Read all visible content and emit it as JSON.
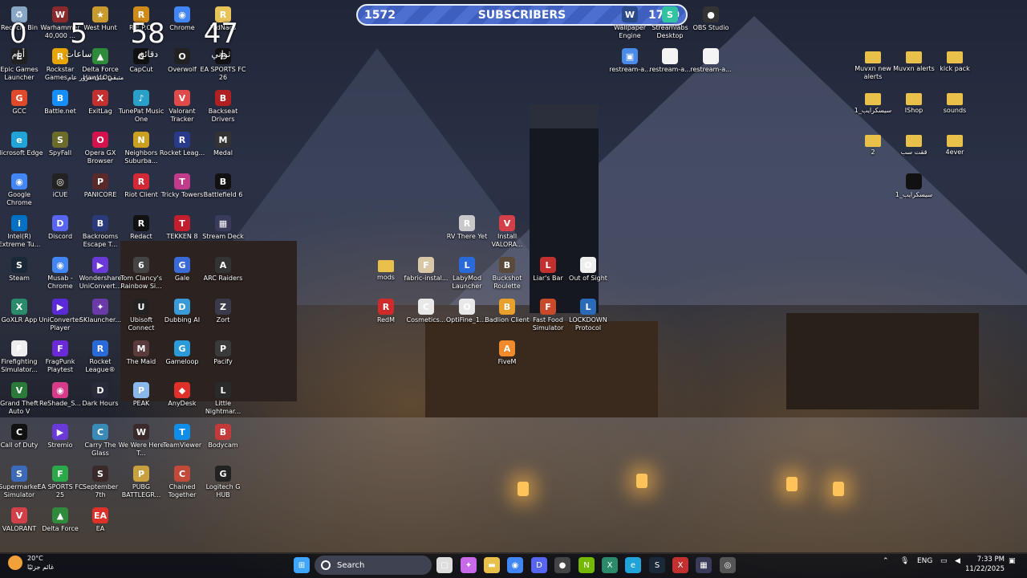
{
  "subscriber_bar": {
    "count": "1572",
    "label": "SUBSCRIBERS",
    "goal": "1700",
    "progress": 0.92
  },
  "countdown": [
    {
      "value": "0",
      "unit": "أيام"
    },
    {
      "value": "5",
      "unit": "ساعات"
    },
    {
      "value": "58",
      "unit": "دقائق"
    },
    {
      "value": "47",
      "unit": "ثواني"
    }
  ],
  "countdown_note": "متبقي على مرور عام",
  "desktop_icons": [
    {
      "label": "Recycle Bin",
      "icon": "recycle-bin-icon",
      "color": "#8aa6c7",
      "glyph": "♻"
    },
    {
      "label": "Warhammer 40,000 ...",
      "icon": "warhammer-icon",
      "color": "#8a2a2a",
      "glyph": "W"
    },
    {
      "label": "West Hunt",
      "icon": "west-hunt-icon",
      "color": "#c99a2e",
      "glyph": "★"
    },
    {
      "label": "R.E.P.O.",
      "icon": "repo-icon",
      "color": "#d08a1a",
      "glyph": "R"
    },
    {
      "label": "Chrome",
      "icon": "chrome-icon",
      "color": "#4285f4",
      "glyph": "◉"
    },
    {
      "label": "RidNacs",
      "icon": "ridnacs-icon",
      "color": "#e8c35a",
      "glyph": "R"
    },
    {
      "label": "Epic Games Launcher",
      "icon": "epic-games-icon",
      "color": "#222",
      "glyph": "E"
    },
    {
      "label": "Rockstar Games ...",
      "icon": "rockstar-icon",
      "color": "#e8a400",
      "glyph": "R"
    },
    {
      "label": "Delta Force Hawk Op...",
      "icon": "delta-force-icon",
      "color": "#2f8a3c",
      "glyph": "▲"
    },
    {
      "label": "CapCut",
      "icon": "capcut-icon",
      "color": "#111",
      "glyph": "C"
    },
    {
      "label": "Overwolf",
      "icon": "overwolf-icon",
      "color": "#222",
      "glyph": "O"
    },
    {
      "label": "EA SPORTS FC 26",
      "icon": "ea-fc26-icon",
      "color": "#111",
      "glyph": "F"
    },
    {
      "label": "GCC",
      "icon": "gcc-icon",
      "color": "#e04a2a",
      "glyph": "G"
    },
    {
      "label": "Battle.net",
      "icon": "battlenet-icon",
      "color": "#148eff",
      "glyph": "B"
    },
    {
      "label": "ExitLag",
      "icon": "exitlag-icon",
      "color": "#c23030",
      "glyph": "X"
    },
    {
      "label": "TunePat Music One",
      "icon": "tunepat-icon",
      "color": "#2aa0c8",
      "glyph": "♪"
    },
    {
      "label": "Valorant Tracker",
      "icon": "valorant-tracker-icon",
      "color": "#e04a4a",
      "glyph": "V"
    },
    {
      "label": "Backseat Drivers",
      "icon": "backseat-icon",
      "color": "#b02020",
      "glyph": "B"
    },
    {
      "label": "Microsoft Edge",
      "icon": "edge-icon",
      "color": "#1fa3d8",
      "glyph": "e"
    },
    {
      "label": "SpyFall",
      "icon": "spyfall-icon",
      "color": "#6b6b2a",
      "glyph": "S"
    },
    {
      "label": "Opera GX Browser",
      "icon": "opera-gx-icon",
      "color": "#d4124c",
      "glyph": "O"
    },
    {
      "label": "Neighbors Suburba...",
      "icon": "neighbors-icon",
      "color": "#c9a022",
      "glyph": "N"
    },
    {
      "label": "Rocket Leag...",
      "icon": "rocket-league-icon",
      "color": "#2a3a8a",
      "glyph": "R"
    },
    {
      "label": "Medal",
      "icon": "medal-icon",
      "color": "#333",
      "glyph": "M"
    },
    {
      "label": "Google Chrome",
      "icon": "google-chrome-icon",
      "color": "#4285f4",
      "glyph": "◉"
    },
    {
      "label": "iCUE",
      "icon": "icue-icon",
      "color": "#222",
      "glyph": "◎"
    },
    {
      "label": "PANICORE",
      "icon": "panicore-icon",
      "color": "#5a2a2a",
      "glyph": "P"
    },
    {
      "label": "Riot Client",
      "icon": "riot-client-icon",
      "color": "#d32936",
      "glyph": "R"
    },
    {
      "label": "Tricky Towers",
      "icon": "tricky-towers-icon",
      "color": "#c23a8a",
      "glyph": "T"
    },
    {
      "label": "Battlefield 6",
      "icon": "battlefield-icon",
      "color": "#111",
      "glyph": "B"
    },
    {
      "label": "Intel(R) Extreme Tu...",
      "icon": "intel-xtu-icon",
      "color": "#0071c5",
      "glyph": "i"
    },
    {
      "label": "Discord",
      "icon": "discord-icon",
      "color": "#5865f2",
      "glyph": "D"
    },
    {
      "label": "Backrooms Escape T...",
      "icon": "backrooms-icon",
      "color": "#2a3a7a",
      "glyph": "B"
    },
    {
      "label": "Redact",
      "icon": "redact-icon",
      "color": "#111",
      "glyph": "R"
    },
    {
      "label": "TEKKEN 8",
      "icon": "tekken-icon",
      "color": "#c21e2e",
      "glyph": "T"
    },
    {
      "label": "Stream Deck",
      "icon": "stream-deck-icon",
      "color": "#3a3a5a",
      "glyph": "▦"
    },
    {
      "label": "Steam",
      "icon": "steam-icon",
      "color": "#1b2838",
      "glyph": "S"
    },
    {
      "label": "Musab - Chrome",
      "icon": "musab-chrome-icon",
      "color": "#4285f4",
      "glyph": "◉"
    },
    {
      "label": "Wondershare UniConvert...",
      "icon": "uniconverter-icon",
      "color": "#6a3ad8",
      "glyph": "▶"
    },
    {
      "label": "Tom Clancy's Rainbow Si...",
      "icon": "rainbow-six-icon",
      "color": "#444",
      "glyph": "6"
    },
    {
      "label": "Gale",
      "icon": "gale-icon",
      "color": "#3a6ad8",
      "glyph": "G"
    },
    {
      "label": "ARC Raiders",
      "icon": "arc-raiders-icon",
      "color": "#333",
      "glyph": "A"
    },
    {
      "label": "GoXLR App",
      "icon": "goxlr-icon",
      "color": "#2a8a6a",
      "glyph": "X"
    },
    {
      "label": "UniConverter Player",
      "icon": "uniconverter-player-icon",
      "color": "#5a2ad8",
      "glyph": "▶"
    },
    {
      "label": "SKlauncher...",
      "icon": "sklauncher-icon",
      "color": "#6a3aa8",
      "glyph": "✦"
    },
    {
      "label": "Ubisoft Connect",
      "icon": "ubisoft-icon",
      "color": "#222",
      "glyph": "U"
    },
    {
      "label": "Dubbing AI",
      "icon": "dubbing-ai-icon",
      "color": "#3a9ad8",
      "glyph": "D"
    },
    {
      "label": "Zort",
      "icon": "zort-icon",
      "color": "#3a3a4a",
      "glyph": "Z"
    },
    {
      "label": "Firefighting Simulator...",
      "icon": "firefighting-icon",
      "color": "#eee",
      "glyph": "F"
    },
    {
      "label": "FragPunk Playtest",
      "icon": "fragpunk-icon",
      "color": "#6a2ad8",
      "glyph": "F"
    },
    {
      "label": "Rocket League®",
      "icon": "rocket-league-2-icon",
      "color": "#2a6ad8",
      "glyph": "R"
    },
    {
      "label": "The Maid",
      "icon": "the-maid-icon",
      "color": "#5a3a3a",
      "glyph": "M"
    },
    {
      "label": "Gameloop",
      "icon": "gameloop-icon",
      "color": "#2a9ad8",
      "glyph": "G"
    },
    {
      "label": "Pacify",
      "icon": "pacify-icon",
      "color": "#3a3a3a",
      "glyph": "P"
    },
    {
      "label": "Grand Theft Auto V",
      "icon": "gta-v-icon",
      "color": "#2a7a3a",
      "glyph": "V"
    },
    {
      "label": "ReShade_S...",
      "icon": "reshade-icon",
      "color": "#d83a8a",
      "glyph": "◉"
    },
    {
      "label": "Dark Hours",
      "icon": "dark-hours-icon",
      "color": "#2a2a3a",
      "glyph": "D"
    },
    {
      "label": "PEAK",
      "icon": "peak-icon",
      "color": "#8ab8e8",
      "glyph": "P"
    },
    {
      "label": "AnyDesk",
      "icon": "anydesk-icon",
      "color": "#e0302a",
      "glyph": "◆"
    },
    {
      "label": "Little Nightmar...",
      "icon": "little-nightmares-icon",
      "color": "#2a2a2a",
      "glyph": "L"
    },
    {
      "label": "Call of Duty",
      "icon": "call-of-duty-icon",
      "color": "#111",
      "glyph": "C"
    },
    {
      "label": "Stremio",
      "icon": "stremio-icon",
      "color": "#6a3ad8",
      "glyph": "▶"
    },
    {
      "label": "Carry The Glass",
      "icon": "carry-the-glass-icon",
      "color": "#3a8ab8",
      "glyph": "C"
    },
    {
      "label": "We Were Here T...",
      "icon": "we-were-here-icon",
      "color": "#3a2a2a",
      "glyph": "W"
    },
    {
      "label": "TeamViewer",
      "icon": "teamviewer-icon",
      "color": "#0e8ee9",
      "glyph": "T"
    },
    {
      "label": "Bodycam",
      "icon": "bodycam-icon",
      "color": "#c23a3a",
      "glyph": "B"
    },
    {
      "label": "Supermarket Simulator",
      "icon": "supermarket-icon",
      "color": "#3a6ab8",
      "glyph": "S"
    },
    {
      "label": "EA SPORTS FC 25",
      "icon": "ea-fc25-icon",
      "color": "#2aa84a",
      "glyph": "F"
    },
    {
      "label": "September 7th",
      "icon": "september-icon",
      "color": "#3a2a2a",
      "glyph": "S"
    },
    {
      "label": "PUBG BATTLEGR...",
      "icon": "pubg-icon",
      "color": "#c8a040",
      "glyph": "P"
    },
    {
      "label": "Chained Together",
      "icon": "chained-together-icon",
      "color": "#c24a3a",
      "glyph": "C"
    },
    {
      "label": "Logitech G HUB",
      "icon": "logitech-icon",
      "color": "#222",
      "glyph": "G"
    },
    {
      "label": "VALORANT",
      "icon": "valorant-icon",
      "color": "#d3404a",
      "glyph": "V"
    },
    {
      "label": "Delta Force",
      "icon": "delta-force-2-icon",
      "color": "#2f8a3c",
      "glyph": "▲"
    },
    {
      "label": "EA",
      "icon": "ea-icon",
      "color": "#e0302a",
      "glyph": "EA"
    },
    {
      "label": "Wallpaper Engine",
      "icon": "wallpaper-engine-icon",
      "color": "#2a4a8a",
      "glyph": "W"
    },
    {
      "label": "Streamlabs Desktop",
      "icon": "streamlabs-icon",
      "color": "#31c3a2",
      "glyph": "S"
    },
    {
      "label": "OBS Studio",
      "icon": "obs-icon",
      "color": "#333",
      "glyph": "●"
    },
    {
      "label": "restream-a...",
      "icon": "restream-icon",
      "color": "#4a8ae8",
      "glyph": "▣"
    },
    {
      "label": "restream-a...",
      "icon": "file-icon",
      "color": "#f4f4f4",
      "glyph": ""
    },
    {
      "label": "restream-a...",
      "icon": "file-icon",
      "color": "#f4f4f4",
      "glyph": ""
    },
    {
      "label": "RV There Yet",
      "icon": "rv-there-yet-icon",
      "color": "#c8c8c8",
      "glyph": "R"
    },
    {
      "label": "Install VALORA...",
      "icon": "install-valorant-icon",
      "color": "#d3404a",
      "glyph": "V"
    },
    {
      "label": "mods",
      "icon": "folder-icon",
      "color": "#e8c04a",
      "glyph": ""
    },
    {
      "label": "fabric-instal...",
      "icon": "fabric-icon",
      "color": "#d8c8a8",
      "glyph": "F"
    },
    {
      "label": "LabyMod Launcher",
      "icon": "labymod-icon",
      "color": "#2a6ad8",
      "glyph": "L"
    },
    {
      "label": "Buckshot Roulette",
      "icon": "buckshot-icon",
      "color": "#5a4a3a",
      "glyph": "B"
    },
    {
      "label": "Liar's Bar",
      "icon": "liars-bar-icon",
      "color": "#c23030",
      "glyph": "L"
    },
    {
      "label": "Out of Sight",
      "icon": "out-of-sight-icon",
      "color": "#eee",
      "glyph": "O"
    },
    {
      "label": "RedM",
      "icon": "redm-icon",
      "color": "#d02a2a",
      "glyph": "R"
    },
    {
      "label": "Cosmetics...",
      "icon": "cosmetics-icon",
      "color": "#e8e8e8",
      "glyph": "C"
    },
    {
      "label": "OptiFine_1....",
      "icon": "optifine-icon",
      "color": "#e8e8e8",
      "glyph": "O"
    },
    {
      "label": "Badlion Client",
      "icon": "badlion-icon",
      "color": "#e8a02a",
      "glyph": "B"
    },
    {
      "label": "Fast Food Simulator",
      "icon": "fast-food-icon",
      "color": "#c84a2a",
      "glyph": "F"
    },
    {
      "label": "LOCKDOWN Protocol",
      "icon": "lockdown-icon",
      "color": "#2a6ab8",
      "glyph": "L"
    },
    {
      "label": "FiveM",
      "icon": "fivem-icon",
      "color": "#f08a2a",
      "glyph": "A"
    },
    {
      "label": "Muvxn new alerts",
      "icon": "folder-icon",
      "color": "#e8c04a",
      "glyph": ""
    },
    {
      "label": "Muvxn alerts",
      "icon": "folder-icon",
      "color": "#e8c04a",
      "glyph": ""
    },
    {
      "label": "kick pack",
      "icon": "folder-icon",
      "color": "#e8c04a",
      "glyph": ""
    },
    {
      "label": "سيسكرايب_1",
      "icon": "folder-icon",
      "color": "#e8c04a",
      "glyph": ""
    },
    {
      "label": "IShop",
      "icon": "folder-icon",
      "color": "#e8c04a",
      "glyph": ""
    },
    {
      "label": "sounds",
      "icon": "folder-icon",
      "color": "#e8c04a",
      "glyph": ""
    },
    {
      "label": "2",
      "icon": "folder-icon",
      "color": "#e8c04a",
      "glyph": ""
    },
    {
      "label": "ققت سب",
      "icon": "folder-icon",
      "color": "#e8c04a",
      "glyph": ""
    },
    {
      "label": "4ever",
      "icon": "folder-icon",
      "color": "#e8c04a",
      "glyph": ""
    },
    {
      "label": "سيسكرايب_1",
      "icon": "file-dark-icon",
      "color": "#111",
      "glyph": ""
    }
  ],
  "taskbar": {
    "weather": {
      "temp": "20°C",
      "desc": "غائم جزئيًا"
    },
    "search_placeholder": "Search",
    "apps": [
      {
        "name": "start-button",
        "glyph": "⊞",
        "color": "#3ea6ff"
      },
      {
        "name": "task-view-icon",
        "glyph": "▢",
        "color": "#ddd"
      },
      {
        "name": "copilot-icon",
        "glyph": "✦",
        "color": "#c86ae8"
      },
      {
        "name": "file-explorer-icon",
        "glyph": "▬",
        "color": "#e8c04a"
      },
      {
        "name": "chrome-taskbar-icon",
        "glyph": "◉",
        "color": "#4285f4"
      },
      {
        "name": "discord-taskbar-icon",
        "glyph": "D",
        "color": "#5865f2"
      },
      {
        "name": "obs-taskbar-icon",
        "glyph": "●",
        "color": "#444"
      },
      {
        "name": "nvidia-icon",
        "glyph": "N",
        "color": "#76b900"
      },
      {
        "name": "goxlr-taskbar-icon",
        "glyph": "X",
        "color": "#2a8a6a"
      },
      {
        "name": "edge-taskbar-icon",
        "glyph": "e",
        "color": "#1fa3d8"
      },
      {
        "name": "steam-taskbar-icon",
        "glyph": "S",
        "color": "#1b2838"
      },
      {
        "name": "exitlag-taskbar-icon",
        "glyph": "X",
        "color": "#c23030"
      },
      {
        "name": "stream-deck-taskbar-icon",
        "glyph": "▦",
        "color": "#3a3a5a"
      },
      {
        "name": "obs-studio-taskbar-icon",
        "glyph": "◎",
        "color": "#555"
      }
    ],
    "tray": {
      "lang": "ENG",
      "time": "7:33 PM",
      "date": "11/22/2025"
    }
  }
}
